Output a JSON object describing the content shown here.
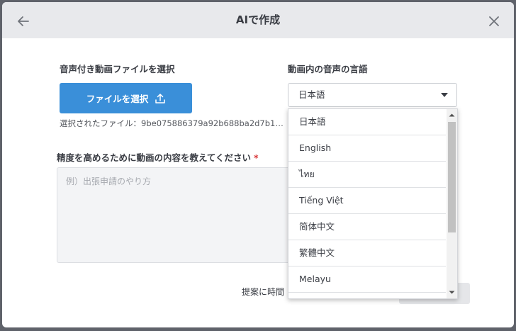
{
  "modal": {
    "title": "AIで作成"
  },
  "video_file": {
    "label": "音声付き動画ファイルを選択",
    "button_label": "ファイルを選択",
    "selected_file": "選択されたファイル：9be075886379a92b688ba2d7b1…"
  },
  "language": {
    "label": "動画内の音声の言語",
    "selected": "日本語",
    "options": [
      "日本語",
      "English",
      "ไทย",
      "Tiếng Việt",
      "简体中文",
      "繁體中文",
      "Melayu"
    ]
  },
  "content": {
    "label": "精度を高めるために動画の内容を教えてください",
    "required_mark": "*",
    "placeholder": "例）出張申請のやり方"
  },
  "footer": {
    "hint": "提案に時間"
  },
  "icons": {
    "back": "arrow-left-icon",
    "close": "close-icon",
    "upload": "upload-icon",
    "caret": "caret-down-icon"
  },
  "colors": {
    "accent": "#3a8fd9",
    "required": "#d9383a",
    "header_bg": "#e8e9ec"
  }
}
